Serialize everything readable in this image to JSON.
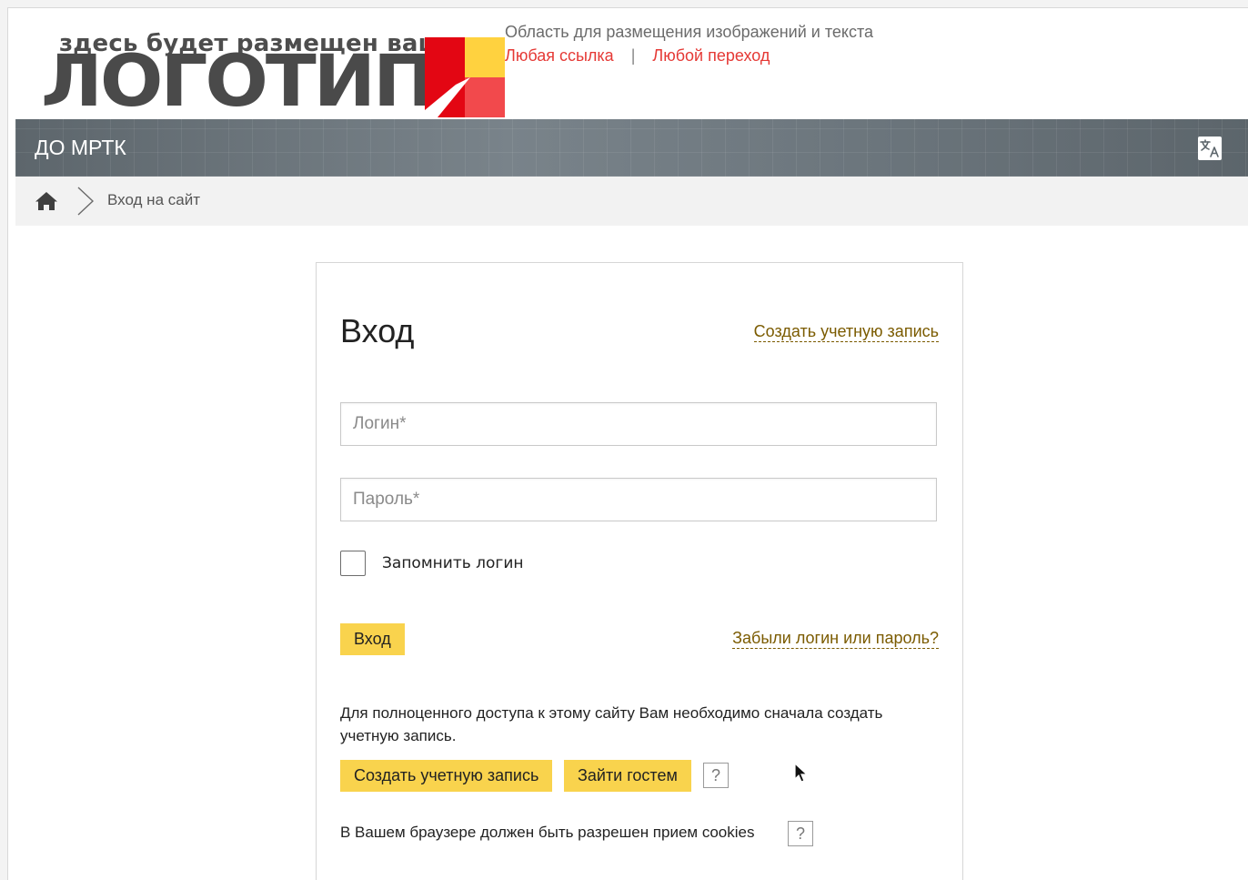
{
  "header": {
    "logo": {
      "small_text": "здесь будет размещен ваш",
      "big_text": "ЛОГОТИП",
      "mark_colors": [
        "#e30613",
        "#ffd23f",
        "#f2494c",
        "#ffffff"
      ]
    },
    "tagline": "Область для размещения изображений и текста",
    "links": [
      {
        "label": "Любая ссылка"
      },
      {
        "label": "Любой переход"
      }
    ],
    "link_separator": "|",
    "link_color": "#e53935"
  },
  "navbar": {
    "site_name": "ДО МРТК",
    "translate_icon": "translate-icon"
  },
  "breadcrumb": {
    "home_icon": "home-icon",
    "current": "Вход на сайт"
  },
  "login": {
    "title": "Вход",
    "create_account_link": "Создать учетную запись",
    "username_placeholder": "Логин*",
    "username_value": "",
    "password_placeholder": "Пароль*",
    "password_value": "",
    "remember_label": "Запомнить логин",
    "remember_checked": false,
    "submit_label": "Вход",
    "forgot_link": "Забыли логин или пароль?",
    "info_text": "Для полноценного доступа к этому сайту Вам необходимо сначала создать учетную запись.",
    "create_account_button": "Создать учетную запись",
    "guest_button": "Зайти гостем",
    "help_label": "?",
    "cookies_text": "В Вашем браузере должен быть разрешен прием cookies"
  },
  "colors": {
    "accent_button": "#f9d34d",
    "link_dark": "#7b5b00",
    "navbar": "#6a747b"
  }
}
